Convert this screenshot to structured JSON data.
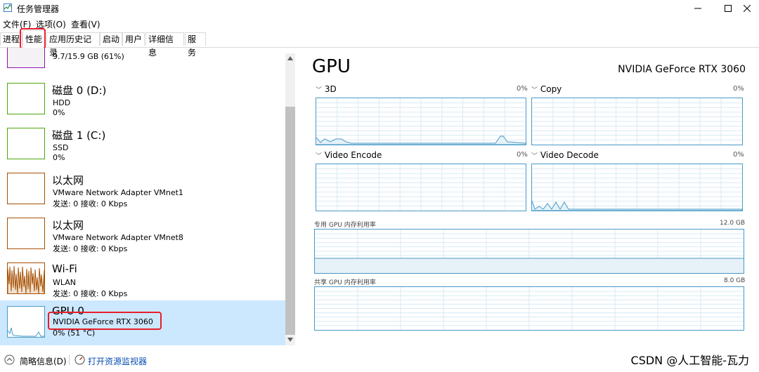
{
  "window": {
    "title": "任务管理器"
  },
  "menu": {
    "file": "文件(F)",
    "options": "选项(O)",
    "view": "查看(V)"
  },
  "tabs": [
    "进程",
    "性能",
    "应用历史记录",
    "启动",
    "用户",
    "详细信息",
    "服务"
  ],
  "devices": [
    {
      "name": "",
      "line2": "9.7/15.9 GB (61%)",
      "line3": ""
    },
    {
      "name": "磁盘 0 (D:)",
      "line2": "HDD",
      "line3": "0%"
    },
    {
      "name": "磁盘 1 (C:)",
      "line2": "SSD",
      "line3": "0%"
    },
    {
      "name": "以太网",
      "line2": "VMware Network Adapter VMnet1",
      "line3": "发送: 0 接收: 0 Kbps"
    },
    {
      "name": "以太网",
      "line2": "VMware Network Adapter VMnet8",
      "line3": "发送: 0 接收: 0 Kbps"
    },
    {
      "name": "Wi-Fi",
      "line2": "WLAN",
      "line3": "发送: 0 接收: 0 Kbps"
    },
    {
      "name": "GPU 0",
      "line2": "NVIDIA GeForce RTX 3060",
      "line3": "0% (51 °C)"
    }
  ],
  "detail": {
    "title": "GPU",
    "model": "NVIDIA GeForce RTX 3060",
    "engines": [
      {
        "label": "3D",
        "pct": "0%"
      },
      {
        "label": "Copy",
        "pct": "0%"
      },
      {
        "label": "Video Encode",
        "pct": "0%"
      },
      {
        "label": "Video Decode",
        "pct": "0%"
      }
    ],
    "dedicated_label": "专用 GPU 内存利用率",
    "dedicated_max": "12.0 GB",
    "shared_label": "共享 GPU 内存利用率",
    "shared_max": "8.0 GB"
  },
  "footer": {
    "brief": "简略信息(D)",
    "monitor": "打开资源监视器"
  },
  "watermark": "CSDN @人工智能-瓦力",
  "colors": {
    "accent": "#479ac8",
    "selected": "#cce8ff",
    "highlight": "#e81e2a",
    "disk": "#4da60c",
    "network": "#a74f01"
  }
}
